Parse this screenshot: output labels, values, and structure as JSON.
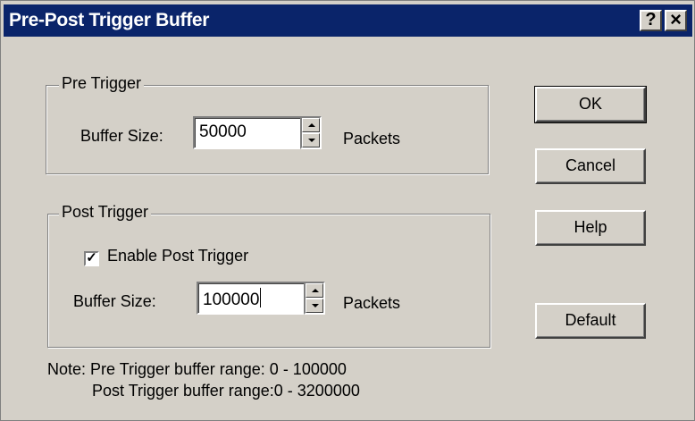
{
  "window": {
    "title": "Pre-Post Trigger Buffer",
    "help_glyph": "?",
    "close_glyph": "×"
  },
  "pre_trigger": {
    "group_label": "Pre Trigger",
    "buffer_label": "Buffer Size:",
    "buffer_value": "50000",
    "unit_label": "Packets"
  },
  "post_trigger": {
    "group_label": "Post Trigger",
    "enable_label": "Enable Post Trigger",
    "enable_checked": true,
    "check_glyph": "✓",
    "buffer_label": "Buffer Size:",
    "buffer_value": "100000",
    "unit_label": "Packets"
  },
  "buttons": {
    "ok": "OK",
    "cancel": "Cancel",
    "help": "Help",
    "default": "Default"
  },
  "notes": {
    "line1": "Note: Pre Trigger buffer range:  0 - 100000",
    "line2": "Post Trigger buffer range:0 - 3200000"
  }
}
